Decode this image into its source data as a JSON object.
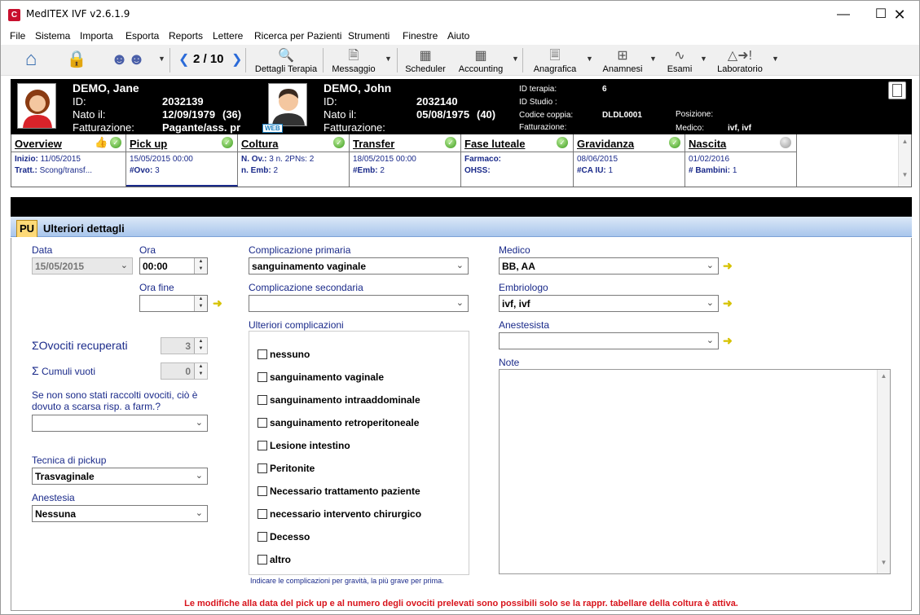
{
  "window": {
    "title": "MedITEX IVF v2.6.1.9",
    "app_icon": "C"
  },
  "menu": [
    "File",
    "Sistema",
    "Importa",
    "Esporta",
    "Reports",
    "Lettere",
    "Ricerca per Pazienti",
    "Strumenti",
    "Finestre",
    "Aiuto"
  ],
  "toolbar": {
    "pager": "2 / 10",
    "dettagli": "Dettagli Terapia",
    "messaggio": "Messaggio",
    "scheduler": "Scheduler",
    "accounting": "Accounting",
    "anagrafica": "Anagrafica",
    "anamnesi": "Anamnesi",
    "esami": "Esami",
    "laboratorio": "Laboratorio"
  },
  "female": {
    "name": "DEMO, Jane",
    "id_label": "ID:",
    "id": "2032139",
    "dob_label": "Nato il:",
    "dob": "12/09/1979",
    "age": "(36)",
    "billing_label": "Fatturazione:",
    "billing": "Pagante/ass. pr"
  },
  "male": {
    "name": "DEMO, John",
    "id_label": "ID:",
    "id": "2032140",
    "dob_label": "Nato il:",
    "dob": "05/08/1975",
    "age": "(40)",
    "billing_label": "Fatturazione:",
    "web": "WEB"
  },
  "therapy": {
    "id_label": "ID terapia:",
    "id": "6",
    "study_label": "ID Studio :",
    "couple_label": "Codice coppia:",
    "couple": "DLDL0001",
    "billing_label": "Fatturazione:",
    "position_label": "Posizione:",
    "doctor_label": "Medico:",
    "doctor": "ivf, ivf"
  },
  "steps": [
    {
      "title": "Overview",
      "l1k": "Inizio:",
      "l1v": "11/05/2015",
      "l2k": "Tratt.:",
      "l2v": "Scong/transf..."
    },
    {
      "title": "Pick up",
      "l1k": "",
      "l1v": "15/05/2015 00:00",
      "l2k": "#Ovo:",
      "l2v": "3"
    },
    {
      "title": "Coltura",
      "l1k": "N. Ov.:",
      "l1v": "3 n. 2PNs: 2",
      "l2k": "n. Emb:",
      "l2v": "2"
    },
    {
      "title": "Transfer",
      "l1k": "",
      "l1v": "18/05/2015 00:00",
      "l2k": "#Emb:",
      "l2v": "2"
    },
    {
      "title": "Fase luteale",
      "l1k": "Farmaco:",
      "l1v": "",
      "l2k": "OHSS:",
      "l2v": ""
    },
    {
      "title": "Gravidanza",
      "l1k": "",
      "l1v": "08/06/2015",
      "l2k": "#CA IU:",
      "l2v": "1"
    },
    {
      "title": "Nascita",
      "l1k": "",
      "l1v": "01/02/2016",
      "l2k": "# Bambini:",
      "l2v": "1"
    }
  ],
  "tabs": {
    "pu": "PU",
    "more": "Ulteriori dettagli"
  },
  "form": {
    "data_label": "Data",
    "data": "15/05/2015",
    "ora_label": "Ora",
    "ora": "00:00",
    "ora_fine_label": "Ora fine",
    "ora_fine": "",
    "ovociti_label": "Ovociti recuperati",
    "ovociti": "3",
    "cumuli_label": "Cumuli vuoti",
    "cumuli": "0",
    "scarsa_label": "Se non sono stati raccolti ovociti, ciò è dovuto a scarsa risp. a farm.?",
    "scarsa": "",
    "tecnica_label": "Tecnica di pickup",
    "tecnica": "Trasvaginale",
    "anestesia_label": "Anestesia",
    "anestesia": "Nessuna",
    "comp1_label": "Complicazione primaria",
    "comp1": "sanguinamento vaginale",
    "comp2_label": "Complicazione secondaria",
    "comp2": "",
    "ulteriori_label": "Ulteriori complicazioni",
    "complications": [
      "nessuno",
      "sanguinamento vaginale",
      "sanguinamento intraaddominale",
      "sanguinamento retroperitoneale",
      "Lesione intestino",
      "Peritonite",
      "Necessario trattamento paziente",
      "necessario intervento chirurgico",
      "Decesso",
      "altro"
    ],
    "comp_hint": "Indicare le complicazioni per gravità, la più grave per prima.",
    "medico_label": "Medico",
    "medico": "BB, AA",
    "embriologo_label": "Embriologo",
    "embriologo": "ivf, ivf",
    "anestesista_label": "Anestesista",
    "anestesista": "",
    "note_label": "Note",
    "footer": "Le modifiche alla data del pick up e al numero degli ovociti prelevati sono possibili solo se la rappr. tabellare della coltura è attiva."
  }
}
